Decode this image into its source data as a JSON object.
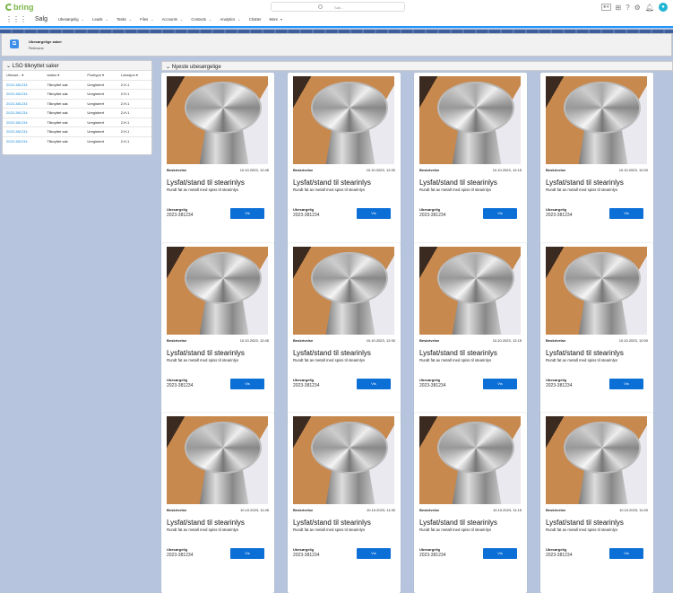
{
  "header": {
    "brand": "bring",
    "search_placeholder": "Søk...",
    "app_name": "Salg",
    "avatar": "●"
  },
  "nav": [
    {
      "label": "Ubesørgelig"
    },
    {
      "label": "Leads"
    },
    {
      "label": "Tasks"
    },
    {
      "label": "Files"
    },
    {
      "label": "Accounts"
    },
    {
      "label": "Contacts"
    },
    {
      "label": "Analytics"
    },
    {
      "label": "Chatter",
      "nochev": true
    },
    {
      "label": "More",
      "more": true
    }
  ],
  "banner": {
    "title": "Ubesørgelige saker",
    "subtitle": "Relevans"
  },
  "left_panel": {
    "title": "LSO tilknyttet saker",
    "columns": [
      "Ubesør...",
      "status",
      "Posttype",
      "Lokasjon"
    ],
    "rows": [
      [
        "2023-381234",
        "Tilknyttet sak",
        "Uregistrert",
        "2.H.1"
      ],
      [
        "2023-381234",
        "Tilknyttet sak",
        "Uregistrert",
        "2.H.1"
      ],
      [
        "2023-381234",
        "Tilknyttet sak",
        "Uregistrert",
        "2.H.1"
      ],
      [
        "2023-381234",
        "Tilknyttet sak",
        "Uregistrert",
        "2.H.1"
      ],
      [
        "2023-381234",
        "Tilknyttet sak",
        "Uregistrert",
        "2.H.1"
      ],
      [
        "2023-381234",
        "Tilknyttet sak",
        "Uregistrert",
        "2.H.1"
      ],
      [
        "2023-381234",
        "Tilknyttet sak",
        "Uregistrert",
        "2.H.1"
      ]
    ]
  },
  "right_panel": {
    "title": "Nyeste ubesørgelige"
  },
  "cards": [
    {
      "date": "10.10.2023, 12:45"
    },
    {
      "date": "10.10.2023, 12:30"
    },
    {
      "date": "10.10.2023, 12:15"
    },
    {
      "date": "10.10.2023, 12:00"
    },
    {
      "date": "10.10.2023, 12:45"
    },
    {
      "date": "10.10.2023, 12:30"
    },
    {
      "date": "10.10.2023, 12:15"
    },
    {
      "date": "10.10.2023, 12:00"
    },
    {
      "date": "10.10.2023, 11:45"
    },
    {
      "date": "10.10.2023, 11:30"
    },
    {
      "date": "10.10.2023, 11:15"
    },
    {
      "date": "10.10.2023, 11:00"
    }
  ],
  "card_common": {
    "desc_label": "Beskrivelse",
    "title": "Lysfat/stand til stearinlys",
    "subtitle": "Rundt fat av metall med spiss til stearinlys",
    "status_label": "Ubesørgelig",
    "case_number": "2023-381234",
    "button": "Vis"
  }
}
